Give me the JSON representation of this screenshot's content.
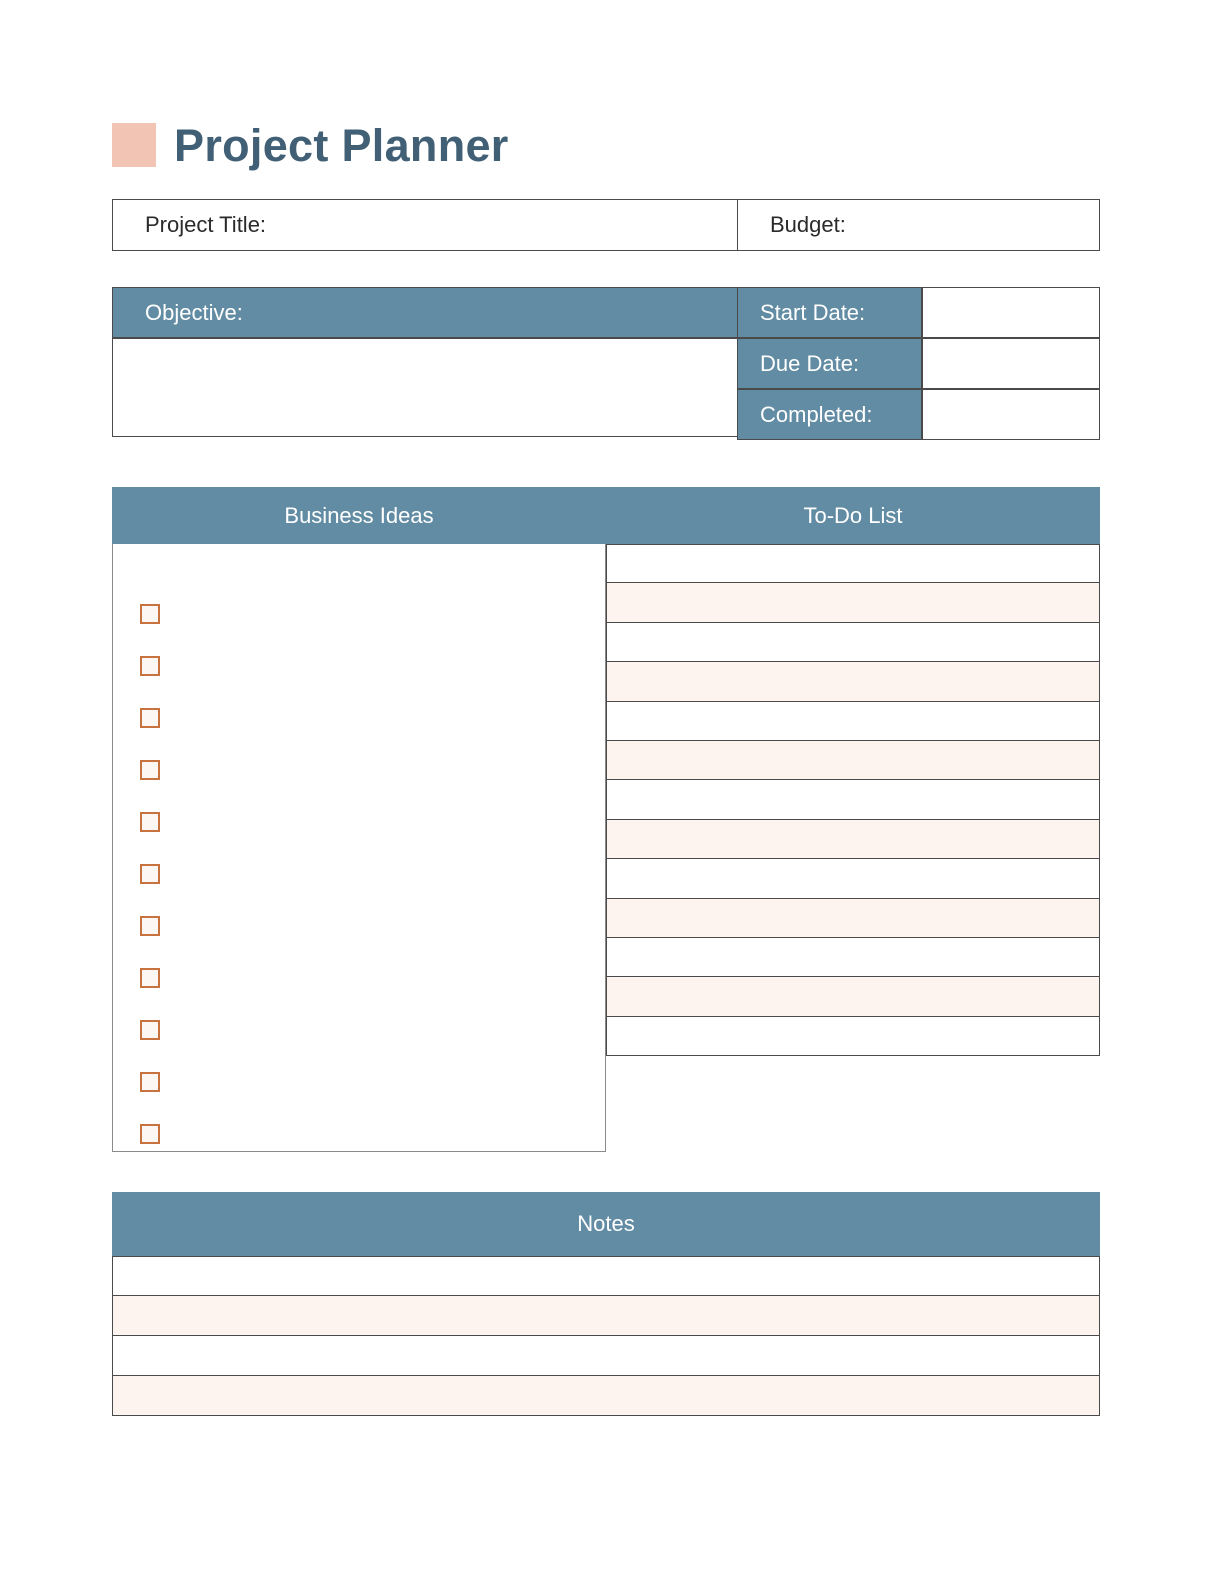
{
  "document": {
    "title": "Project Planner",
    "accent_color": "#F2C4B3",
    "title_color": "#416075",
    "header_color": "#628CA3",
    "alt_row_color": "#FDF4F0",
    "checkbox_border_color": "#C8733F"
  },
  "info_row": {
    "project_title_label": "Project Title:",
    "project_title_value": "",
    "budget_label": "Budget:",
    "budget_value": ""
  },
  "objective": {
    "label": "Objective:",
    "value": ""
  },
  "dates": [
    {
      "label": "Start Date:",
      "value": ""
    },
    {
      "label": "Due Date:",
      "value": ""
    },
    {
      "label": "Completed:",
      "value": ""
    }
  ],
  "business_ideas": {
    "header": "Business Ideas",
    "items": [
      {
        "checked": false,
        "text": ""
      },
      {
        "checked": false,
        "text": ""
      },
      {
        "checked": false,
        "text": ""
      },
      {
        "checked": false,
        "text": ""
      },
      {
        "checked": false,
        "text": ""
      },
      {
        "checked": false,
        "text": ""
      },
      {
        "checked": false,
        "text": ""
      },
      {
        "checked": false,
        "text": ""
      },
      {
        "checked": false,
        "text": ""
      },
      {
        "checked": false,
        "text": ""
      },
      {
        "checked": false,
        "text": ""
      }
    ]
  },
  "todo_list": {
    "header": "To-Do List",
    "rows": [
      {
        "text": "",
        "shaded": false
      },
      {
        "text": "",
        "shaded": true
      },
      {
        "text": "",
        "shaded": false
      },
      {
        "text": "",
        "shaded": true
      },
      {
        "text": "",
        "shaded": false
      },
      {
        "text": "",
        "shaded": true
      },
      {
        "text": "",
        "shaded": false
      },
      {
        "text": "",
        "shaded": true
      },
      {
        "text": "",
        "shaded": false
      },
      {
        "text": "",
        "shaded": true
      },
      {
        "text": "",
        "shaded": false
      },
      {
        "text": "",
        "shaded": true
      },
      {
        "text": "",
        "shaded": false
      }
    ]
  },
  "notes": {
    "header": "Notes",
    "rows": [
      {
        "text": "",
        "shaded": false
      },
      {
        "text": "",
        "shaded": true
      },
      {
        "text": "",
        "shaded": false
      },
      {
        "text": "",
        "shaded": true
      }
    ]
  }
}
